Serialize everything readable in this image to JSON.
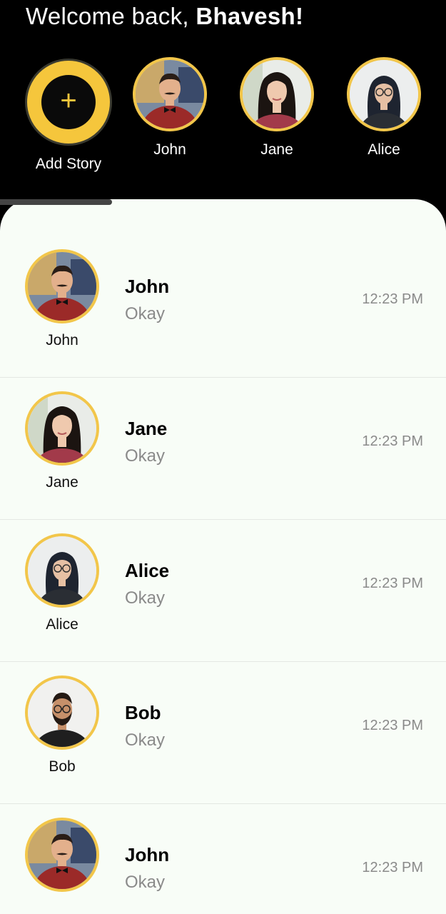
{
  "header": {
    "welcome_prefix": "Welcome back, ",
    "user_name": "Bhavesh!"
  },
  "stories": {
    "add_label": "Add Story",
    "add_symbol": "+",
    "items": [
      {
        "name": "John",
        "avatar": "man-bowtie-avatar"
      },
      {
        "name": "Jane",
        "avatar": "woman-dark-hair-avatar"
      },
      {
        "name": "Alice",
        "avatar": "woman-glasses-avatar"
      }
    ]
  },
  "chats": [
    {
      "name": "John",
      "avatar_label": "John",
      "message": "Okay",
      "time": "12:23 PM"
    },
    {
      "name": "Jane",
      "avatar_label": "Jane",
      "message": "Okay",
      "time": "12:23 PM"
    },
    {
      "name": "Alice",
      "avatar_label": "Alice",
      "message": "Okay",
      "time": "12:23 PM"
    },
    {
      "name": "Bob",
      "avatar_label": "Bob",
      "message": "Okay",
      "time": "12:23 PM"
    },
    {
      "name": "John",
      "avatar_label": "",
      "message": "Okay",
      "time": "12:23 PM"
    }
  ],
  "colors": {
    "background": "#000000",
    "sheet": "#f8fdf7",
    "accent_yellow": "#f2c64a",
    "muted_text": "#8a8a8a"
  }
}
